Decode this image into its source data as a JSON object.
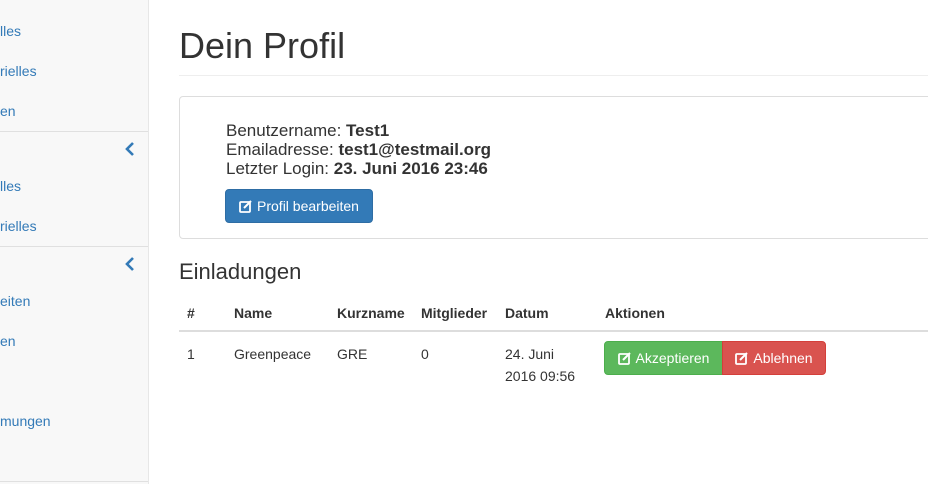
{
  "sidebar": {
    "items": [
      {
        "label": "lles"
      },
      {
        "label": "rielles"
      },
      {
        "label": "en"
      },
      {
        "label": "lles"
      },
      {
        "label": "rielles"
      },
      {
        "label": "eiten"
      },
      {
        "label": "en"
      },
      {
        "label": "mungen"
      }
    ],
    "icons": [
      "chevron-left-icon",
      "chevron-left-icon"
    ]
  },
  "main": {
    "page_title": "Dein Profil",
    "profile": {
      "username_label": "Benutzername:",
      "username": "Test1",
      "email_label": "Emailadresse:",
      "email": "test1@testmail.org",
      "last_login_label": "Letzter Login:",
      "last_login": "23. Juni 2016 23:46",
      "edit_button": "Profil bearbeiten"
    },
    "invitations": {
      "title": "Einladungen",
      "columns": [
        "#",
        "Name",
        "Kurzname",
        "Mitglieder",
        "Datum",
        "Aktionen"
      ],
      "rows": [
        {
          "num": "1",
          "name": "Greenpeace",
          "short": "GRE",
          "members": "0",
          "date_line1": "24. Juni",
          "date_line2": "2016 09:56",
          "accept": "Akzeptieren",
          "decline": "Ablehnen"
        }
      ]
    }
  },
  "colors": {
    "link": "#337ab7",
    "primary": "#337ab7",
    "success": "#5cb85c",
    "danger": "#d9534f"
  }
}
